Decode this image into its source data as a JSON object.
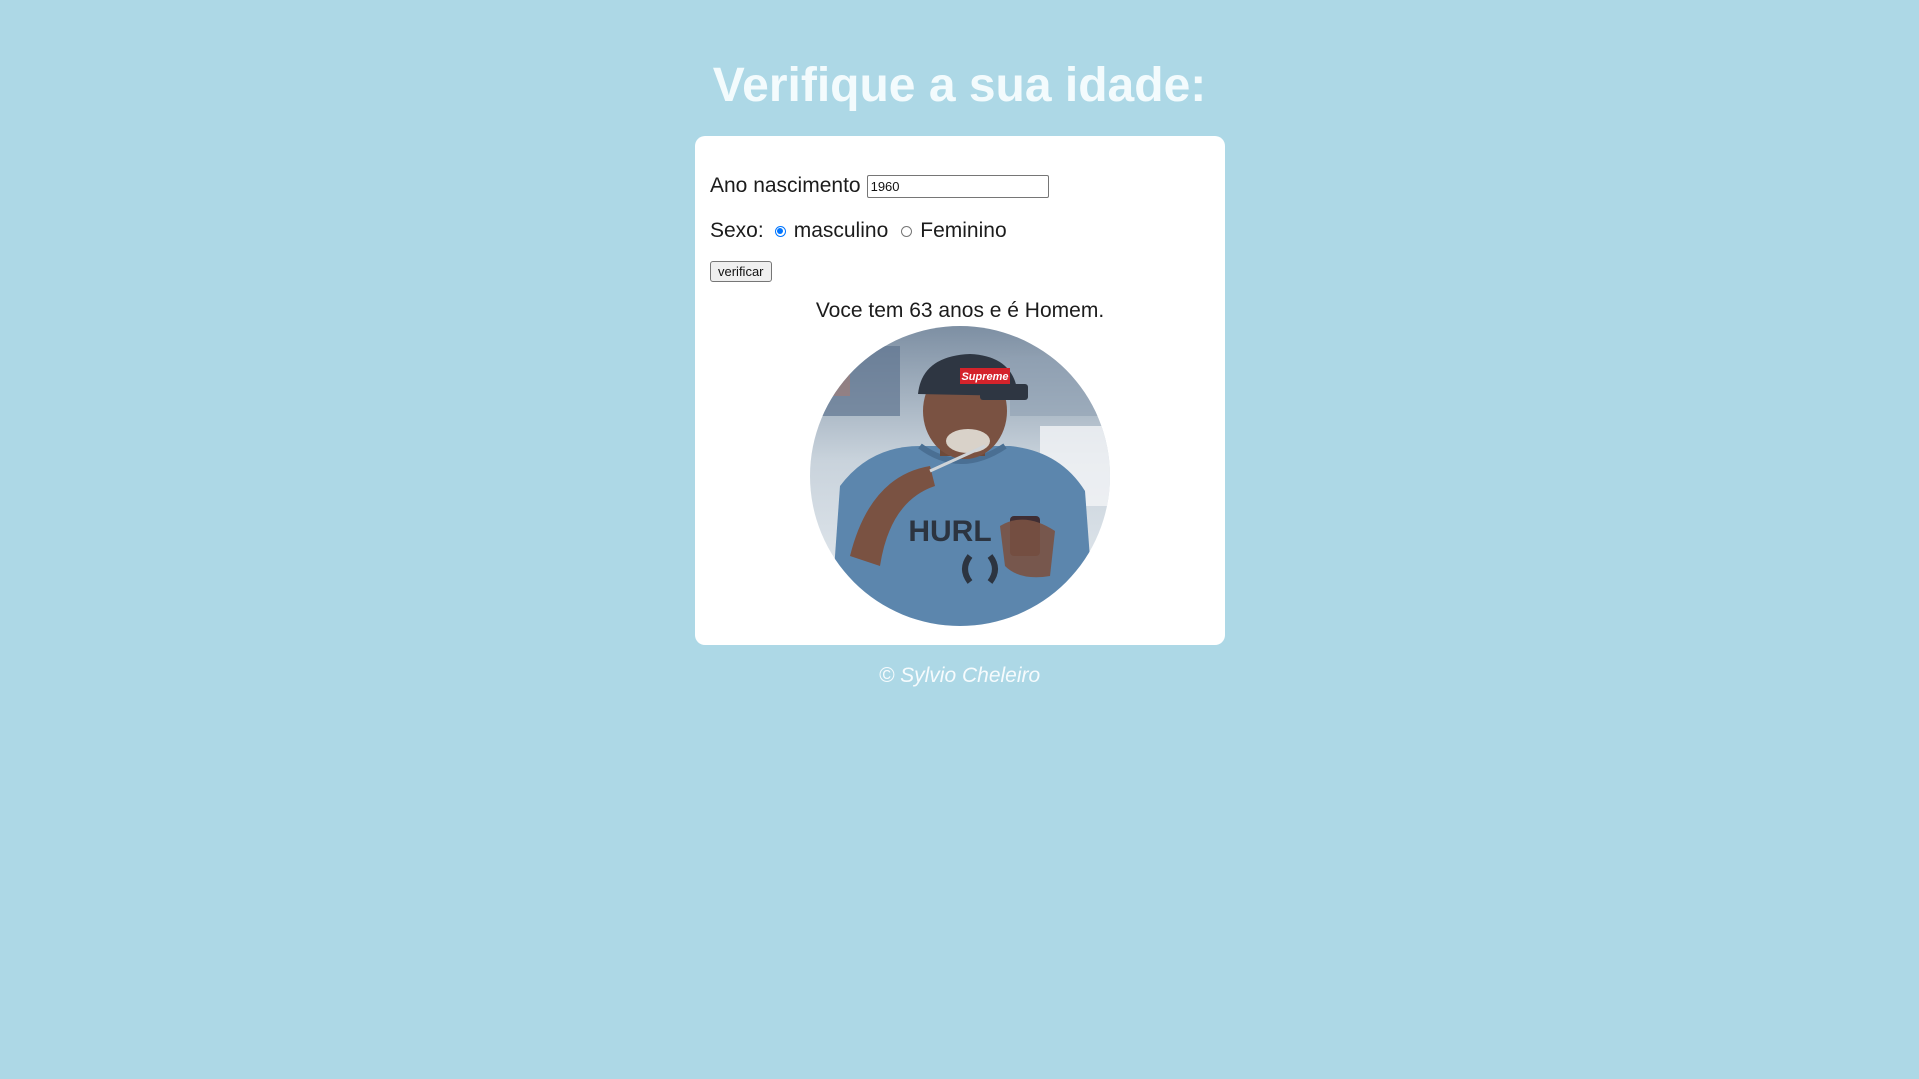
{
  "header": {
    "title": "Verifique a sua idade:"
  },
  "form": {
    "year_label": "Ano nascimento",
    "year_value": "1960",
    "sex_label": "Sexo:",
    "sex_options": [
      {
        "label": "masculino",
        "checked": true
      },
      {
        "label": "Feminino",
        "checked": false
      }
    ],
    "submit_label": "verificar"
  },
  "result": {
    "message": "Voce tem 63 anos e é Homem.",
    "photo_icon": "elderly-man-photo",
    "photo_texts": {
      "cap_logo": "Supreme",
      "shirt_logo": "HURL"
    }
  },
  "footer": {
    "text": "© Sylvio Cheleiro"
  },
  "colors": {
    "background": "#add8e6",
    "card": "#ffffff",
    "radio_accent": "#0075ff"
  }
}
